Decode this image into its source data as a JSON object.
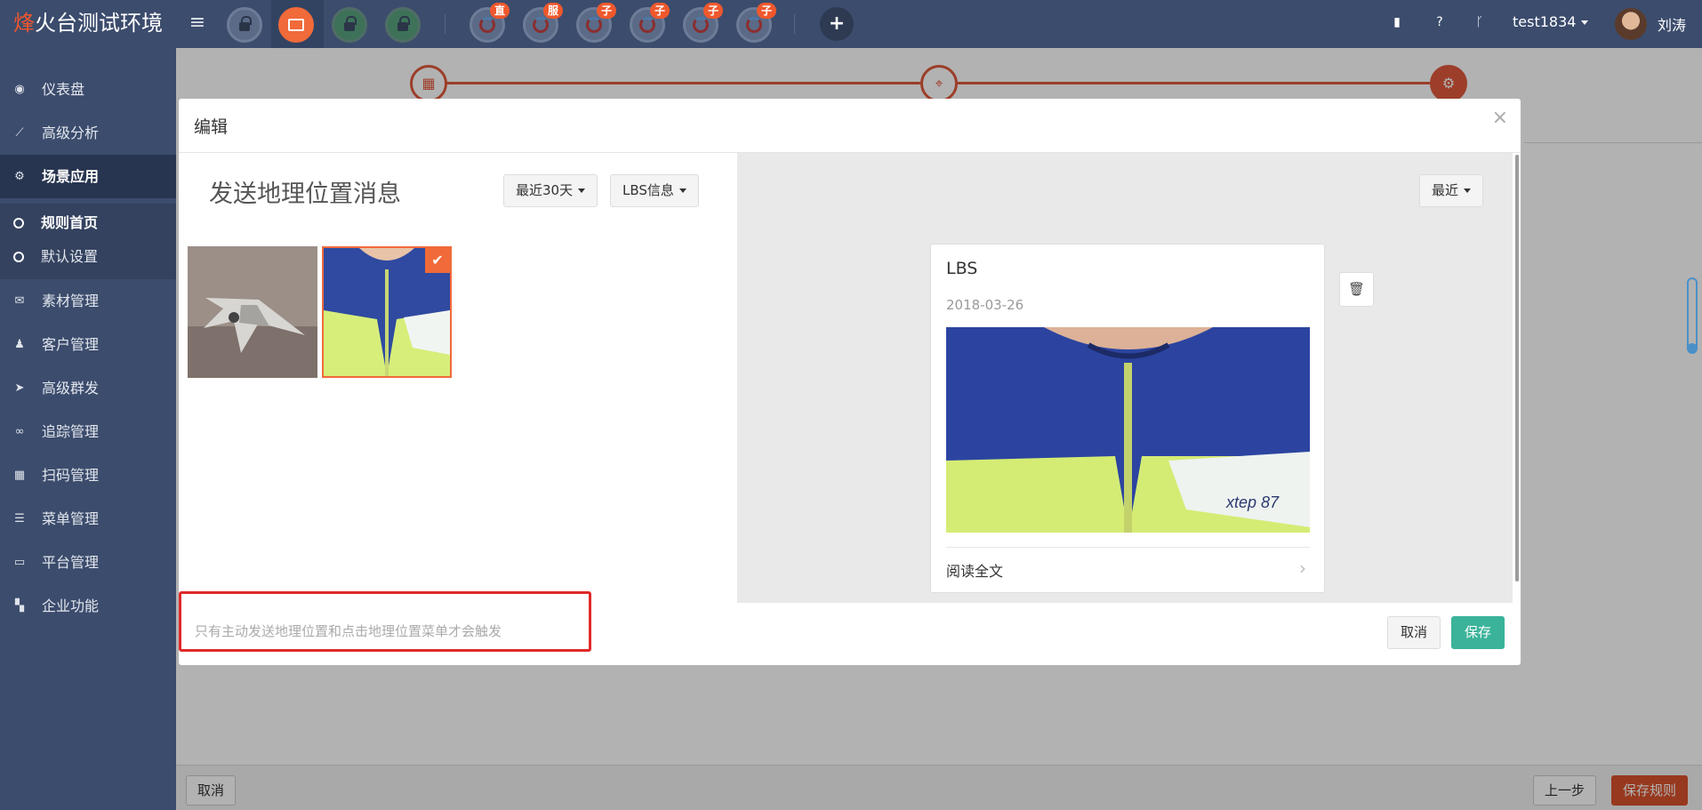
{
  "topbar": {
    "logo_first": "烽",
    "logo_rest": "火台测试环境",
    "user_account": "test1834",
    "user_name": "刘涛",
    "badges": [
      "直",
      "服",
      "子",
      "子",
      "子",
      "子"
    ]
  },
  "sidebar": {
    "items": [
      {
        "label": "仪表盘",
        "icon": "dashboard-icon"
      },
      {
        "label": "高级分析",
        "icon": "line-chart-icon"
      },
      {
        "label": "场景应用",
        "icon": "gear-icon"
      },
      {
        "label": "素材管理",
        "icon": "envelope-icon"
      },
      {
        "label": "客户管理",
        "icon": "user-icon"
      },
      {
        "label": "高级群发",
        "icon": "paper-plane-icon"
      },
      {
        "label": "追踪管理",
        "icon": "link-icon"
      },
      {
        "label": "扫码管理",
        "icon": "qrcode-icon"
      },
      {
        "label": "菜单管理",
        "icon": "list-icon"
      },
      {
        "label": "平台管理",
        "icon": "desktop-icon"
      },
      {
        "label": "企业功能",
        "icon": "th-large-icon"
      }
    ],
    "sub_items": [
      {
        "label": "规则首页"
      },
      {
        "label": "默认设置"
      }
    ]
  },
  "page_footer": {
    "cancel": "取消",
    "prev": "上一步",
    "save_rule": "保存规则"
  },
  "modal": {
    "title": "编辑",
    "close": "×",
    "left_title": "发送地理位置消息",
    "filter_days": "最近30天",
    "filter_type": "LBS信息",
    "recent": "最近",
    "card": {
      "title": "LBS",
      "date": "2018-03-26",
      "read_more": "阅读全文"
    },
    "hint": "只有主动发送地理位置和点击地理位置菜单才会触发",
    "cancel": "取消",
    "save": "保存"
  },
  "colors": {
    "topbar": "#3c4c6d",
    "accent": "#f06a3a",
    "primary_button": "#3bb39a",
    "save_rule": "#d9522c",
    "hint_border": "#e02a2a"
  }
}
